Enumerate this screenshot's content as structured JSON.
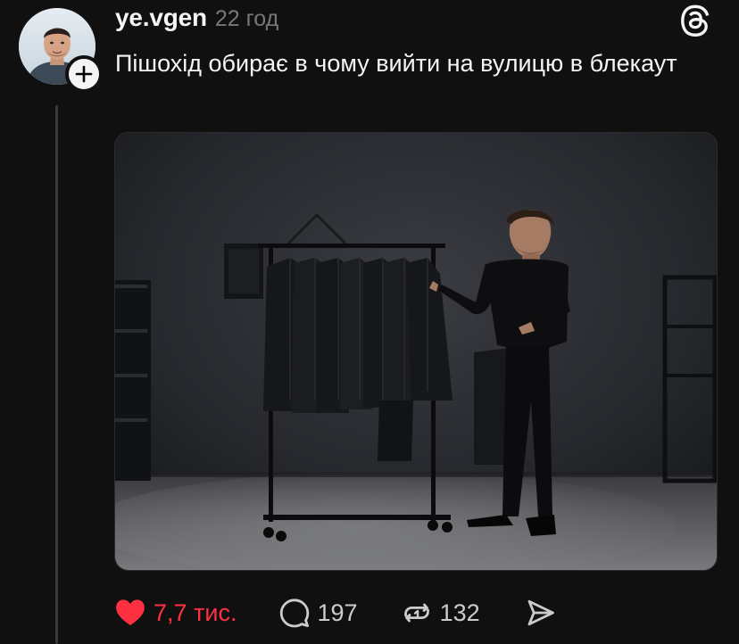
{
  "post": {
    "username": "ye.vgen",
    "timestamp": "22 год",
    "text": "Пішохід обирає в чому вийти на вулицю в блекаут",
    "liked": true
  },
  "actions": {
    "likes": "7,7 тис.",
    "comments": "197",
    "reposts": "132"
  },
  "icons": {
    "like": "heart-icon",
    "comment": "comment-bubble-icon",
    "repost": "repost-icon",
    "share": "send-icon",
    "logo": "threads-logo-icon",
    "follow": "plus-icon"
  },
  "colors": {
    "background": "#101010",
    "text": "#f3f5f7",
    "muted": "#777777",
    "like": "#ff3040"
  }
}
